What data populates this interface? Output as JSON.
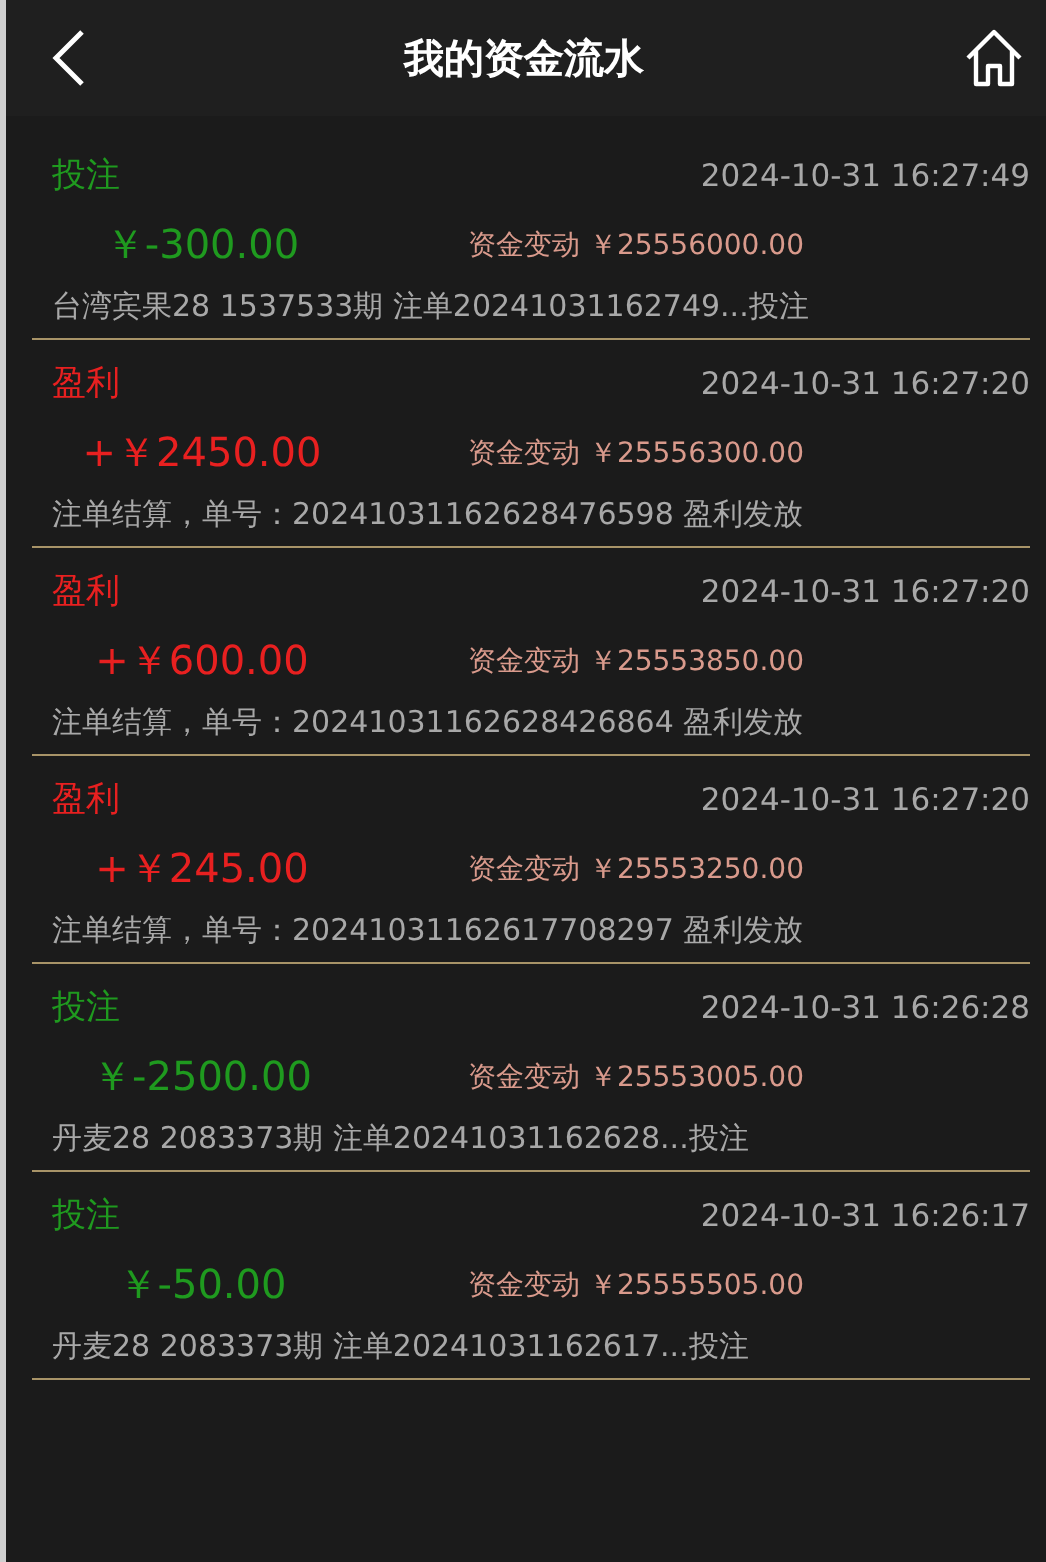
{
  "header": {
    "title": "我的资金流水"
  },
  "records": [
    {
      "kind": "bet",
      "type": "投注",
      "time": "2024-10-31 16:27:49",
      "amount": "￥-300.00",
      "change_label": "资金变动",
      "balance": "￥25556000.00",
      "description": "台湾宾果28 1537533期 注单20241031162749...投注"
    },
    {
      "kind": "win",
      "type": "盈利",
      "time": "2024-10-31 16:27:20",
      "amount": "+￥2450.00",
      "change_label": "资金变动",
      "balance": "￥25556300.00",
      "description": "注单结算，单号：20241031162628476598 盈利发放"
    },
    {
      "kind": "win",
      "type": "盈利",
      "time": "2024-10-31 16:27:20",
      "amount": "+￥600.00",
      "change_label": "资金变动",
      "balance": "￥25553850.00",
      "description": "注单结算，单号：20241031162628426864 盈利发放"
    },
    {
      "kind": "win",
      "type": "盈利",
      "time": "2024-10-31 16:27:20",
      "amount": "+￥245.00",
      "change_label": "资金变动",
      "balance": "￥25553250.00",
      "description": "注单结算，单号：20241031162617708297 盈利发放"
    },
    {
      "kind": "bet",
      "type": "投注",
      "time": "2024-10-31 16:26:28",
      "amount": "￥-2500.00",
      "change_label": "资金变动",
      "balance": "￥25553005.00",
      "description": "丹麦28 2083373期 注单20241031162628...投注"
    },
    {
      "kind": "bet",
      "type": "投注",
      "time": "2024-10-31 16:26:17",
      "amount": "￥-50.00",
      "change_label": "资金变动",
      "balance": "￥25555505.00",
      "description": "丹麦28 2083373期 注单20241031162617...投注"
    }
  ]
}
